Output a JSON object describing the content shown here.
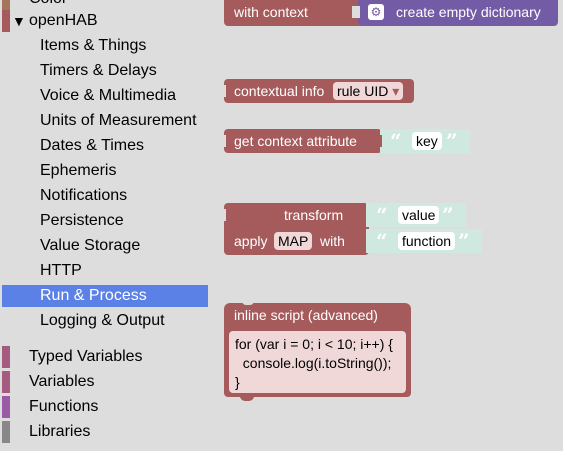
{
  "sidebar": {
    "top_partial": {
      "label": "Color",
      "color": "#a5745b"
    },
    "openhab": {
      "arrow": "▼",
      "label": "openHAB",
      "color": "#a55b5b"
    },
    "sub_items": [
      {
        "label": "Items & Things"
      },
      {
        "label": "Timers & Delays"
      },
      {
        "label": "Voice & Multimedia"
      },
      {
        "label": "Units of Measurement"
      },
      {
        "label": "Dates & Times"
      },
      {
        "label": "Ephemeris"
      },
      {
        "label": "Notifications"
      },
      {
        "label": "Persistence"
      },
      {
        "label": "Value Storage"
      },
      {
        "label": "HTTP"
      },
      {
        "label": "Run & Process",
        "selected": true
      },
      {
        "label": "Logging & Output"
      }
    ],
    "categories": [
      {
        "label": "Typed Variables",
        "color": "#a55b80"
      },
      {
        "label": "Variables",
        "color": "#a55b80"
      },
      {
        "label": "Functions",
        "color": "#995ba5"
      },
      {
        "label": "Libraries",
        "color": "#888888"
      }
    ]
  },
  "blocks": {
    "with_context": {
      "label": "with context",
      "dict_label": "create empty dictionary",
      "color": "#a55b5b",
      "dict_color": "#745ba5"
    },
    "contextual_info": {
      "label": "contextual info",
      "dropdown": "rule UID",
      "arrow": "▾"
    },
    "get_context_attribute": {
      "label": "get context attribute",
      "text": "key"
    },
    "transform": {
      "label": "transform",
      "value_text": "value",
      "apply_label": "apply",
      "method": "MAP",
      "with_label": "with",
      "function_text": "function"
    },
    "inline_script": {
      "label": "inline script (advanced)",
      "code": "for (var i = 0; i < 10; i++) {\n  console.log(i.toString());\n}"
    },
    "quote_open": "“",
    "quote_close": "”",
    "block_color": "#a55b5b",
    "text_block_color": "#cfe8e0"
  }
}
